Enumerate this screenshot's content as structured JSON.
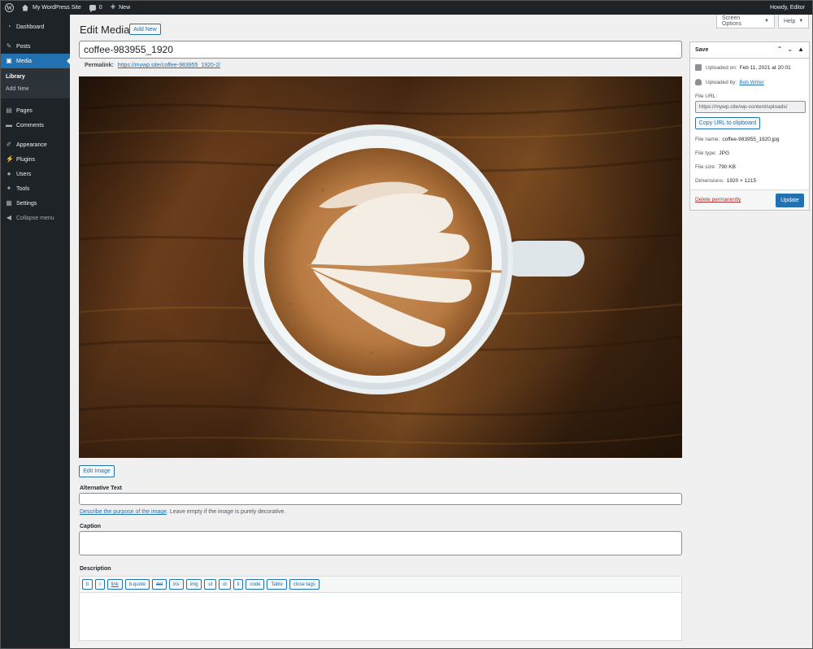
{
  "adminbar": {
    "site_name": "My WordPress Site",
    "comments_count": "0",
    "new_label": "New",
    "howdy": "Howdy, Editor"
  },
  "sidebar": {
    "items": [
      {
        "label": "Dashboard",
        "icon": "dashboard-icon"
      },
      {
        "label": "Posts",
        "icon": "pin-icon"
      },
      {
        "label": "Media",
        "icon": "media-icon"
      },
      {
        "label": "Pages",
        "icon": "page-icon"
      },
      {
        "label": "Comments",
        "icon": "comment-icon"
      },
      {
        "label": "Appearance",
        "icon": "brush-icon"
      },
      {
        "label": "Plugins",
        "icon": "plug-icon"
      },
      {
        "label": "Users",
        "icon": "user-icon"
      },
      {
        "label": "Tools",
        "icon": "wrench-icon"
      },
      {
        "label": "Settings",
        "icon": "settings-icon"
      },
      {
        "label": "Collapse menu",
        "icon": "collapse-icon"
      }
    ],
    "media_submenu": [
      {
        "label": "Library"
      },
      {
        "label": "Add New"
      }
    ]
  },
  "screen_options": "Screen Options",
  "help": "Help",
  "page": {
    "title": "Edit Media",
    "add_new": "Add New",
    "media_title": "coffee-983955_1920",
    "permalink_label": "Permalink:",
    "permalink_url": "https://mywp.site/coffee-983955_1920-2/",
    "edit_image": "Edit Image",
    "alt_label": "Alternative Text",
    "alt_help_link": "Describe the purpose of the image",
    "alt_help_rest": ". Leave empty if the image is purely decorative.",
    "caption_label": "Caption",
    "description_label": "Description"
  },
  "quicktags": [
    "b",
    "i",
    "link",
    "b-quote",
    "del",
    "ins",
    "img",
    "ul",
    "ol",
    "li",
    "code",
    "Table",
    "close tags"
  ],
  "savebox": {
    "title": "Save",
    "uploaded_on_label": "Uploaded on:",
    "uploaded_on": "Feb 11, 2021 at 20:01",
    "uploaded_by_label": "Uploaded by:",
    "uploaded_by": "Bob Writer",
    "file_url_label": "File URL:",
    "file_url": "https://mywp.site/wp-content/uploads/",
    "copy_url": "Copy URL to clipboard",
    "file_name_label": "File name:",
    "file_name": "coffee-983955_1920.jpg",
    "file_type_label": "File type:",
    "file_type": "JPG",
    "file_size_label": "File size:",
    "file_size": "790 KB",
    "dimensions_label": "Dimensions:",
    "dimensions": "1920 × 1215",
    "delete": "Delete permanently",
    "update": "Update"
  },
  "colors": {
    "admin_dark": "#1d2327",
    "accent": "#2271b1",
    "danger": "#b32d2e"
  }
}
